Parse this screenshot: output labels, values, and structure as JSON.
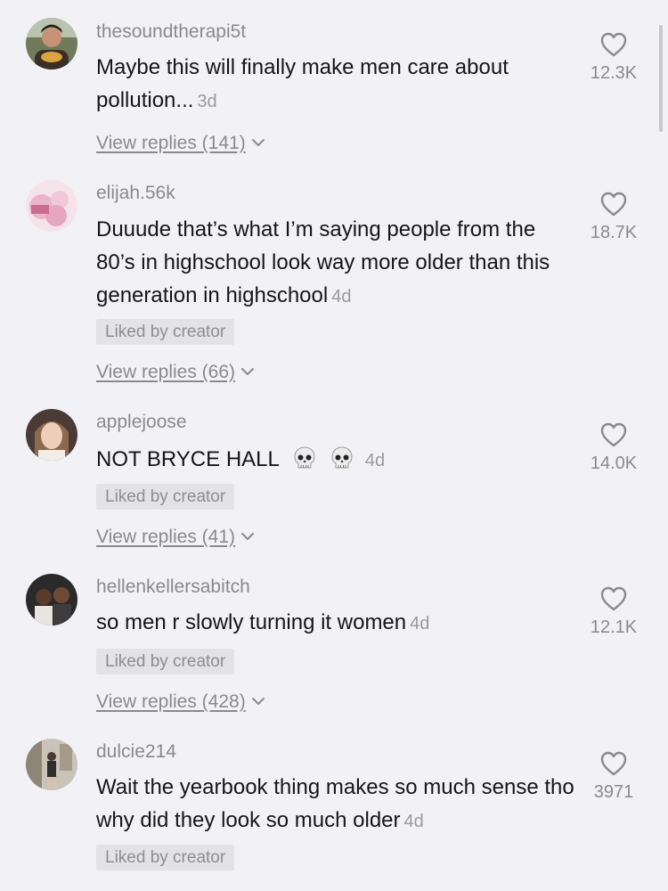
{
  "comments": [
    {
      "username": "thesoundtherapi5t",
      "text": "Maybe this will finally make men care about pollution...",
      "time": "3d",
      "liked_by_creator": "",
      "view_replies": "View replies (141)",
      "likes": "12.3K"
    },
    {
      "username": "elijah.56k",
      "text": "Duuude that’s what I’m saying people from the 80’s in highschool look way more older than this generation in highschool",
      "time": "4d",
      "liked_by_creator": "Liked by creator",
      "view_replies": "View replies (66)",
      "likes": "18.7K"
    },
    {
      "username": "applejoose",
      "text": "NOT BRYCE HALL",
      "emojis": [
        "skull",
        "skull"
      ],
      "time": "4d",
      "liked_by_creator": "Liked by creator",
      "view_replies": "View replies (41)",
      "likes": "14.0K"
    },
    {
      "username": "hellenkellersabitch",
      "text": "so men r slowly turning it women",
      "time": "4d",
      "liked_by_creator": "Liked by creator",
      "view_replies": "View replies (428)",
      "likes": "12.1K"
    },
    {
      "username": "dulcie214",
      "text": "Wait the yearbook thing makes so much sense tho why did they look so much older",
      "time": "4d",
      "liked_by_creator": "Liked by creator",
      "view_replies": "",
      "likes": "3971"
    }
  ],
  "icons": {
    "like": "heart-outline-icon",
    "expand": "chevron-down-icon",
    "emoji": "skull-emoji"
  },
  "colors": {
    "background": "#f2f1f6",
    "text": "#161616",
    "secondary": "#8a8a8e",
    "badge_bg": "#e3e3e6"
  }
}
